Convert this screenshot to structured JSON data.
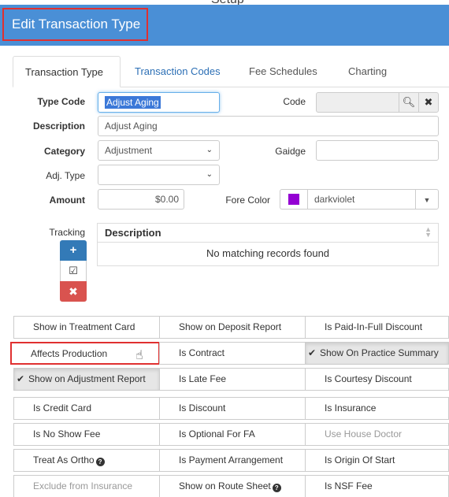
{
  "window": {
    "title": "Edit Transaction Type",
    "ghost_text": "Setup"
  },
  "tabs": [
    "Transaction Type",
    "Transaction Codes",
    "Fee Schedules",
    "Charting"
  ],
  "form": {
    "type_code_label": "Type Code",
    "type_code_value": "Adjust Aging",
    "code_label": "Code",
    "code_value": "",
    "description_label": "Description",
    "description_value": "Adjust Aging",
    "category_label": "Category",
    "category_value": "Adjustment",
    "gaidge_label": "Gaidge",
    "gaidge_value": "",
    "adj_type_label": "Adj. Type",
    "adj_type_value": "",
    "amount_label": "Amount",
    "amount_value": "$0.00",
    "fore_color_label": "Fore Color",
    "fore_color_value": "darkviolet",
    "fore_color_hex": "#9400d3"
  },
  "tracking": {
    "label": "Tracking",
    "column_header": "Description",
    "empty_message": "No matching records found",
    "buttons": {
      "add": "+",
      "edit": "☑",
      "delete": "✖"
    }
  },
  "options": [
    {
      "label": "Show in Treatment Card",
      "checked": false,
      "disabled": false
    },
    {
      "label": "Show on Deposit Report",
      "checked": false,
      "disabled": false
    },
    {
      "label": "Is Paid-In-Full Discount",
      "checked": false,
      "disabled": false
    },
    {
      "label": "Affects Production",
      "checked": false,
      "disabled": false
    },
    {
      "label": "Is Contract",
      "checked": false,
      "disabled": false
    },
    {
      "label": "Show On Practice Summary",
      "checked": true,
      "disabled": false
    },
    {
      "label": "Show on Adjustment Report",
      "checked": true,
      "disabled": false
    },
    {
      "label": "Is Late Fee",
      "checked": false,
      "disabled": false
    },
    {
      "label": "Is Courtesy Discount",
      "checked": false,
      "disabled": false
    },
    {
      "label": "Is Credit Card",
      "checked": false,
      "disabled": false
    },
    {
      "label": "Is Discount",
      "checked": false,
      "disabled": false
    },
    {
      "label": "Is Insurance",
      "checked": false,
      "disabled": false
    },
    {
      "label": "Is No Show Fee",
      "checked": false,
      "disabled": false
    },
    {
      "label": "Is Optional For FA",
      "checked": false,
      "disabled": false
    },
    {
      "label": "Use House Doctor",
      "checked": false,
      "disabled": true
    },
    {
      "label": "Treat As Ortho",
      "checked": false,
      "disabled": false
    },
    {
      "label": "Is Payment Arrangement",
      "checked": false,
      "disabled": false
    },
    {
      "label": "Is Origin Of Start",
      "checked": false,
      "disabled": false
    },
    {
      "label": "Exclude from Insurance",
      "checked": false,
      "disabled": true
    },
    {
      "label": "Show on Route Sheet",
      "checked": false,
      "disabled": false
    },
    {
      "label": "Is NSF Fee",
      "checked": false,
      "disabled": false
    }
  ]
}
